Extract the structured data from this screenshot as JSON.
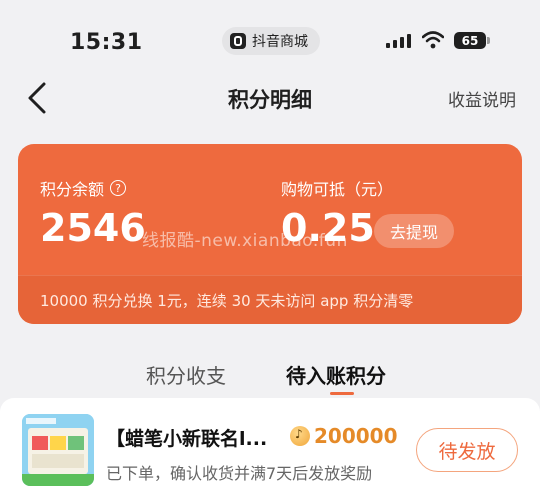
{
  "status_bar": {
    "time": "15:31",
    "app_name": "抖音商城",
    "battery": "65"
  },
  "nav": {
    "title": "积分明细",
    "action": "收益说明",
    "back_icon": "chevron-left-icon"
  },
  "summary": {
    "balance_label": "积分余额",
    "balance_value": "2546",
    "cash_label": "购物可抵（元）",
    "cash_value": "0.25",
    "withdraw_label": "去提现",
    "note": "10000 积分兑换 1元，连续 30 天未访问 app 积分清零",
    "watermark": "线报酷-new.xianbao.fun",
    "accent_color": "#ee6a3e"
  },
  "tabs": [
    {
      "label": "积分收支",
      "active": false
    },
    {
      "label": "待入账积分",
      "active": true
    }
  ],
  "items": [
    {
      "title": "【蜡笔小新联名l...",
      "points": "200000",
      "subtitle": "已下单，确认收货并满7天后发放奖励",
      "status": "待发放"
    }
  ]
}
